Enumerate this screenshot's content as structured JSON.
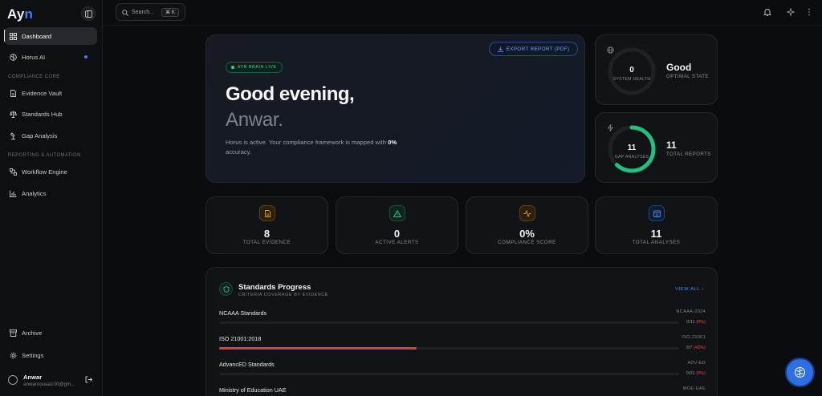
{
  "app": {
    "logo_main": "Ay",
    "logo_accent": "n"
  },
  "sidebar": {
    "items": [
      {
        "label": "Dashboard",
        "icon": "dashboard-icon",
        "active": true
      },
      {
        "label": "Horus AI",
        "icon": "brain-icon",
        "badge_dot": true
      },
      {
        "label": "Evidence Vault",
        "icon": "document-icon"
      },
      {
        "label": "Standards Hub",
        "icon": "scale-icon"
      },
      {
        "label": "Gap Analysis",
        "icon": "magnify-icon"
      },
      {
        "label": "Workflow Engine",
        "icon": "workflow-icon"
      },
      {
        "label": "Analytics",
        "icon": "bar-chart-icon"
      },
      {
        "label": "Archive",
        "icon": "archive-icon"
      },
      {
        "label": "Settings",
        "icon": "gear-icon"
      }
    ],
    "sections": {
      "compliance": "COMPLIANCE CORE",
      "reporting": "REPORTING & AUTOMATION"
    },
    "user": {
      "name": "Anwar",
      "email": "anwarnouaa100@gm..."
    }
  },
  "topbar": {
    "search_placeholder": "Search...",
    "shortcut": "⌘ K"
  },
  "hero": {
    "export_label": "EXPORT REPORT (PDF)",
    "live_badge": "AYN BRAIN LIVE",
    "greeting": "Good evening,",
    "name": "Anwar.",
    "desc_pre": "Horus is active. Your compliance framework is mapped with ",
    "desc_bold": "0%",
    "desc_post": " accuracy."
  },
  "health": {
    "value": "0",
    "label": "SYSTEM HEALTH",
    "state": "Good",
    "state_sub": "OPTIMAL STATE"
  },
  "gap": {
    "value": "11",
    "label": "GAP ANALYSES",
    "reports": "11",
    "reports_label": "TOTAL REPORTS",
    "ring_fraction": 0.62
  },
  "stats": [
    {
      "value": "8",
      "label": "TOTAL EVIDENCE",
      "icon": "file-icon",
      "color": "#e39a2f"
    },
    {
      "value": "0",
      "label": "ACTIVE ALERTS",
      "icon": "alert-triangle-icon",
      "color": "#2fc68a"
    },
    {
      "value": "0%",
      "label": "COMPLIANCE SCORE",
      "icon": "activity-icon",
      "color": "#e39a2f"
    },
    {
      "value": "11",
      "label": "TOTAL ANALYSES",
      "icon": "calendar-icon",
      "color": "#4f8df2"
    }
  ],
  "progress": {
    "title": "Standards Progress",
    "subtitle": "CRITERIA COVERAGE BY EVIDENCE",
    "view_all": "VIEW ALL ›",
    "standards": [
      {
        "name": "NCAAA Standards",
        "code": "NCAAA-2024",
        "count": "0/11",
        "pct_text": "(0%)",
        "fraction": 0
      },
      {
        "name": "ISO 21001:2018",
        "code": "ISO-21001",
        "count": "3/7",
        "pct_text": "(43%)",
        "fraction": 0.43
      },
      {
        "name": "AdvancED Standards",
        "code": "ADV-ED",
        "count": "0/31",
        "pct_text": "(0%)",
        "fraction": 0
      },
      {
        "name": "Ministry of Education UAE",
        "code": "MOE-UAE",
        "count": "",
        "pct_text": "",
        "fraction": 0
      }
    ]
  },
  "colors": {
    "accent": "#3b82f6",
    "success": "#22c07f",
    "danger": "#e23b3b"
  }
}
